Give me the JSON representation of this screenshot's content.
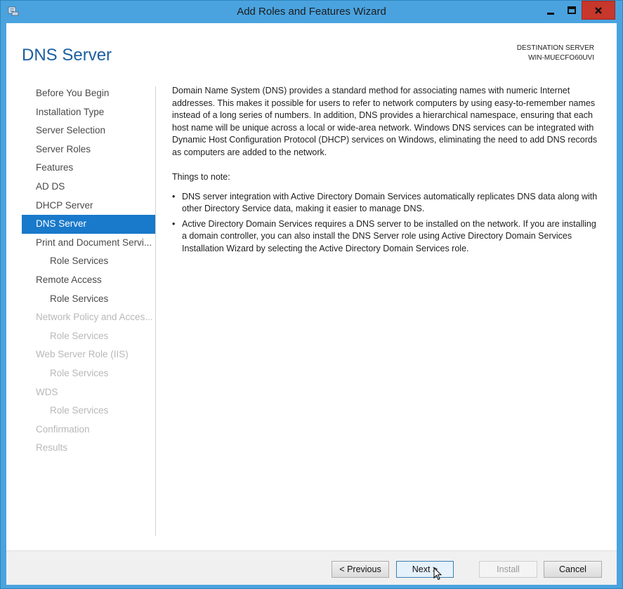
{
  "window": {
    "title": "Add Roles and Features Wizard"
  },
  "header": {
    "page_title": "DNS Server",
    "destination_label": "DESTINATION SERVER",
    "destination_server": "WIN-MUECFO60UVI"
  },
  "nav": {
    "items": [
      {
        "label": "Before You Begin",
        "state": "normal"
      },
      {
        "label": "Installation Type",
        "state": "normal"
      },
      {
        "label": "Server Selection",
        "state": "normal"
      },
      {
        "label": "Server Roles",
        "state": "normal"
      },
      {
        "label": "Features",
        "state": "normal"
      },
      {
        "label": "AD DS",
        "state": "normal"
      },
      {
        "label": "DHCP Server",
        "state": "normal"
      },
      {
        "label": "DNS Server",
        "state": "selected"
      },
      {
        "label": "Print and Document Servi...",
        "state": "normal"
      },
      {
        "label": "Role Services",
        "state": "normal"
      },
      {
        "label": "Remote Access",
        "state": "normal"
      },
      {
        "label": "Role Services",
        "state": "normal"
      },
      {
        "label": "Network Policy and Acces...",
        "state": "disabled"
      },
      {
        "label": "Role Services",
        "state": "disabled"
      },
      {
        "label": "Web Server Role (IIS)",
        "state": "disabled"
      },
      {
        "label": "Role Services",
        "state": "disabled"
      },
      {
        "label": "WDS",
        "state": "disabled"
      },
      {
        "label": "Role Services",
        "state": "disabled"
      },
      {
        "label": "Confirmation",
        "state": "disabled"
      },
      {
        "label": "Results",
        "state": "disabled"
      }
    ]
  },
  "content": {
    "description": "Domain Name System (DNS) provides a standard method for associating names with numeric Internet addresses. This makes it possible for users to refer to network computers by using easy-to-remember names instead of a long series of numbers. In addition, DNS provides a hierarchical namespace, ensuring that each host name will be unique across a local or wide-area network. Windows DNS services can be integrated with Dynamic Host Configuration Protocol (DHCP) services on Windows, eliminating the need to add DNS records as computers are added to the network.",
    "notes_heading": "Things to note:",
    "notes": [
      "DNS server integration with Active Directory Domain Services automatically replicates DNS data along with other Directory Service data, making it easier to manage DNS.",
      "Active Directory Domain Services requires a DNS server to be installed on the network. If you are installing a domain controller, you can also install the DNS Server role using Active Directory Domain Services Installation Wizard by selecting the Active Directory Domain Services role."
    ]
  },
  "footer": {
    "previous_label": "< Previous",
    "next_label": "Next >",
    "install_label": "Install",
    "cancel_label": "Cancel"
  },
  "colors": {
    "title_bar": "#4aa3df",
    "close_button": "#c7372b",
    "page_title": "#1b5fa0",
    "nav_selected": "#1979ca",
    "nav_disabled_text": "#b8b8b8"
  },
  "icons": {
    "app": "server-manager-icon",
    "minimize": "minimize-icon",
    "maximize": "maximize-icon",
    "close": "close-icon",
    "cursor": "mouse-pointer-icon"
  }
}
